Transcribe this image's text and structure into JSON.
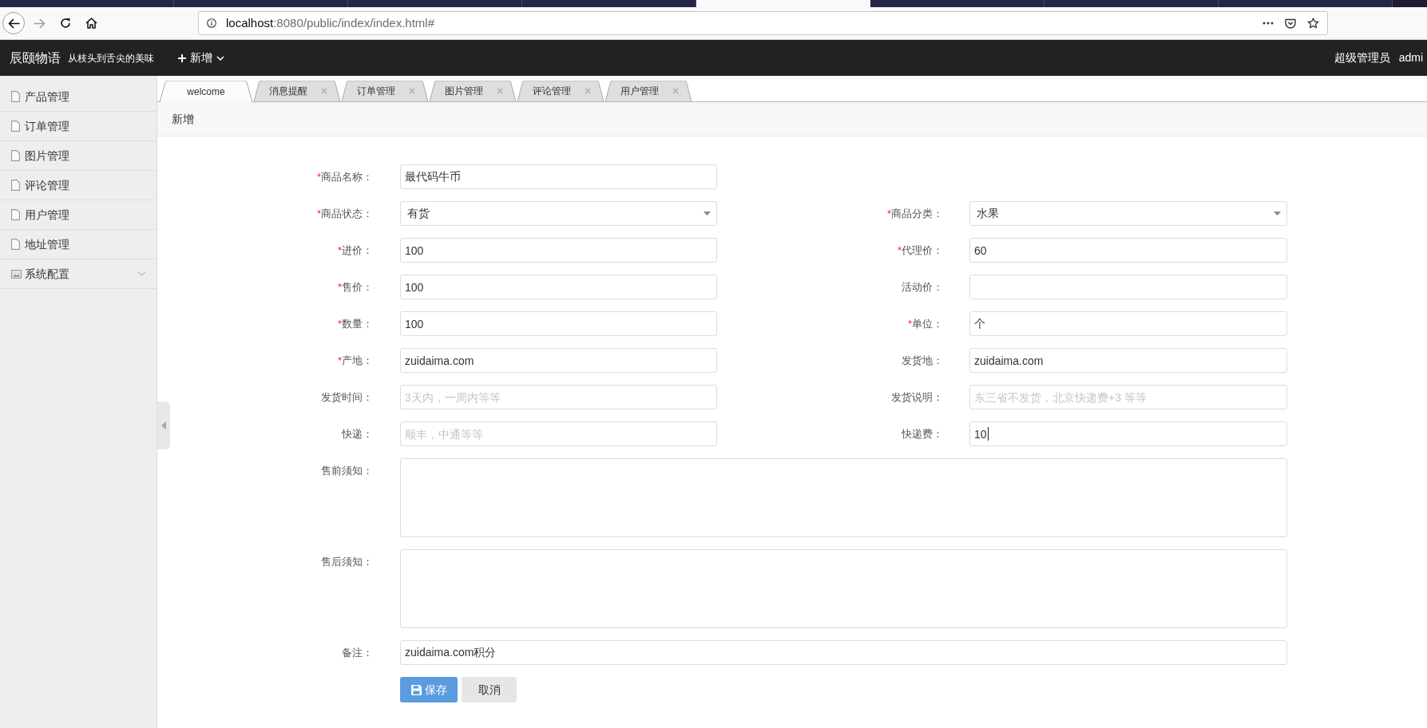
{
  "browser": {
    "tabs": [
      {
        "selected": false
      },
      {
        "selected": false
      },
      {
        "selected": false
      },
      {
        "selected": false
      },
      {
        "selected": true
      },
      {
        "selected": false
      },
      {
        "selected": false
      },
      {
        "selected": false
      }
    ],
    "url": {
      "host": "localhost",
      "path": ":8080/public/index/index.html#"
    }
  },
  "header": {
    "brand": "辰颐物语",
    "slogan": "从枝头到舌尖的美味",
    "menu": "新增",
    "role": "超级管理员",
    "user": "admi"
  },
  "sidebar": {
    "items": [
      {
        "label": "产品管理",
        "kind": "page",
        "selected": false
      },
      {
        "label": "订单管理",
        "kind": "page",
        "selected": false
      },
      {
        "label": "图片管理",
        "kind": "page",
        "selected": false
      },
      {
        "label": "评论管理",
        "kind": "page",
        "selected": false
      },
      {
        "label": "用户管理",
        "kind": "page",
        "selected": false
      },
      {
        "label": "地址管理",
        "kind": "page",
        "selected": false
      },
      {
        "label": "系统配置",
        "kind": "group",
        "selected": false,
        "expanded": false
      }
    ]
  },
  "tabs": [
    {
      "label": "welcome",
      "selected": true,
      "closable": false
    },
    {
      "label": "消息提醒",
      "selected": false,
      "closable": true
    },
    {
      "label": "订单管理",
      "selected": false,
      "closable": true
    },
    {
      "label": "图片管理",
      "selected": false,
      "closable": true
    },
    {
      "label": "评论管理",
      "selected": false,
      "closable": true
    },
    {
      "label": "用户管理",
      "selected": false,
      "closable": true
    }
  ],
  "panel": {
    "title": "新增"
  },
  "form": {
    "rows": [
      {
        "kind": "pair",
        "fields": [
          {
            "label": "商品名称：",
            "required_mark": "*",
            "kind": "text",
            "value": "最代码牛币",
            "focused": false
          }
        ]
      },
      {
        "kind": "pair",
        "fields": [
          {
            "label": "商品状态：",
            "required_mark": "*",
            "kind": "select",
            "value": "有货",
            "focused": false
          },
          {
            "label": "商品分类：",
            "required_mark": "*",
            "kind": "select",
            "value": "水果",
            "focused": false
          }
        ]
      },
      {
        "kind": "pair",
        "fields": [
          {
            "label": "进价：",
            "required_mark": "*",
            "kind": "text",
            "value": "100",
            "focused": false
          },
          {
            "label": "代理价：",
            "required_mark": "*",
            "kind": "text",
            "value": "60",
            "focused": false
          }
        ]
      },
      {
        "kind": "pair",
        "fields": [
          {
            "label": "售价：",
            "required_mark": "*",
            "kind": "text",
            "value": "100",
            "focused": false
          },
          {
            "label": "活动价：",
            "kind": "text",
            "focused": false
          }
        ]
      },
      {
        "kind": "pair",
        "fields": [
          {
            "label": "数量：",
            "required_mark": "*",
            "kind": "text",
            "value": "100",
            "focused": false
          },
          {
            "label": "单位：",
            "required_mark": "*",
            "kind": "text",
            "value": "个",
            "focused": false
          }
        ]
      },
      {
        "kind": "pair",
        "fields": [
          {
            "label": "产地：",
            "required_mark": "*",
            "kind": "text",
            "value": "zuidaima.com",
            "focused": false
          },
          {
            "label": "发货地：",
            "kind": "text",
            "value": "zuidaima.com",
            "focused": false
          }
        ]
      },
      {
        "kind": "pair",
        "fields": [
          {
            "label": "发货时间：",
            "kind": "text",
            "placeholder": "3天内，一周内等等",
            "focused": false
          },
          {
            "label": "发货说明：",
            "kind": "text",
            "placeholder": "东三省不发货，北京快递费+3 等等",
            "focused": false
          }
        ]
      },
      {
        "kind": "pair",
        "fields": [
          {
            "label": "快递：",
            "kind": "text",
            "placeholder": "顺丰，中通等等",
            "focused": false
          },
          {
            "label": "快递费：",
            "kind": "text",
            "value": "10",
            "focused": true
          }
        ]
      },
      {
        "kind": "wide",
        "fields": [
          {
            "label": "售前须知：",
            "kind": "textarea",
            "focused": false
          }
        ]
      },
      {
        "kind": "wide",
        "fields": [
          {
            "label": "售后须知：",
            "kind": "textarea",
            "focused": false
          }
        ]
      },
      {
        "kind": "wide",
        "fields": [
          {
            "label": "备注：",
            "kind": "text",
            "value": "zuidaima.com积分",
            "focused": false
          }
        ]
      }
    ],
    "buttons": [
      {
        "label": "保存",
        "kind": "primary"
      },
      {
        "label": "取消",
        "kind": "default"
      }
    ]
  }
}
